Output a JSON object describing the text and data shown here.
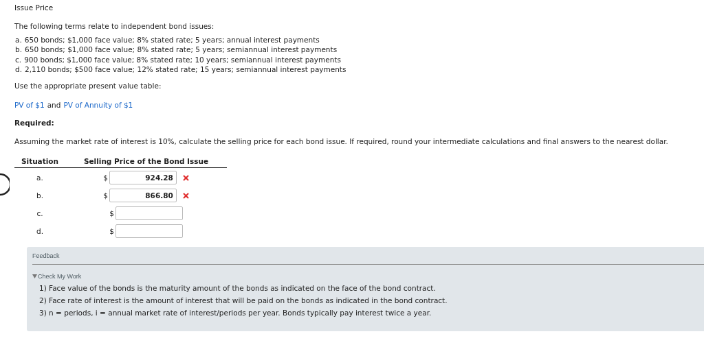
{
  "title": "Issue Price",
  "intro": "The following terms relate to independent bond issues:",
  "terms": [
    {
      "label": "a.",
      "text": "650 bonds; $1,000 face value; 8% stated rate; 5 years; annual interest payments"
    },
    {
      "label": "b.",
      "text": "650 bonds; $1,000 face value; 8% stated rate; 5 years; semiannual interest payments"
    },
    {
      "label": "c.",
      "text": "900 bonds; $1,000 face value; 8% stated rate; 10 years; semiannual interest payments"
    },
    {
      "label": "d.",
      "text": "2,110 bonds; $500 face value; 12% stated rate; 15 years; semiannual interest payments"
    }
  ],
  "table_prompt": "Use the appropriate present value table:",
  "links": [
    "PV of $1",
    "PV of Annuity of $1"
  ],
  "links_joiner": "and",
  "required_heading": "Required:",
  "instruction": "Assuming the market rate of interest is 10%, calculate the selling price for each bond issue. If required, round your intermediate calculations and final answers to the nearest dollar.",
  "table": {
    "columns": [
      "Situation",
      "Selling Price of the Bond Issue"
    ],
    "rows": [
      {
        "situation": "a.",
        "currency": "$",
        "value": "924.28",
        "incorrect": true
      },
      {
        "situation": "b.",
        "currency": "$",
        "value": "866.80",
        "incorrect": true
      },
      {
        "situation": "c.",
        "currency": "$",
        "incorrect": false
      },
      {
        "situation": "d.",
        "currency": "$",
        "incorrect": false
      }
    ]
  },
  "feedback": {
    "title": "Feedback",
    "toggle": {
      "label": "Check My Work",
      "expanded": true
    },
    "items": [
      "1) Face value of the bonds is the maturity amount of the bonds as indicated on the face of the bond contract.",
      "2) Face rate of interest is the amount of interest that will be paid on the bonds as indicated in the bond contract.",
      "3) n = periods, i = annual market rate of interest/periods per year. Bonds typically pay interest twice a year."
    ]
  }
}
